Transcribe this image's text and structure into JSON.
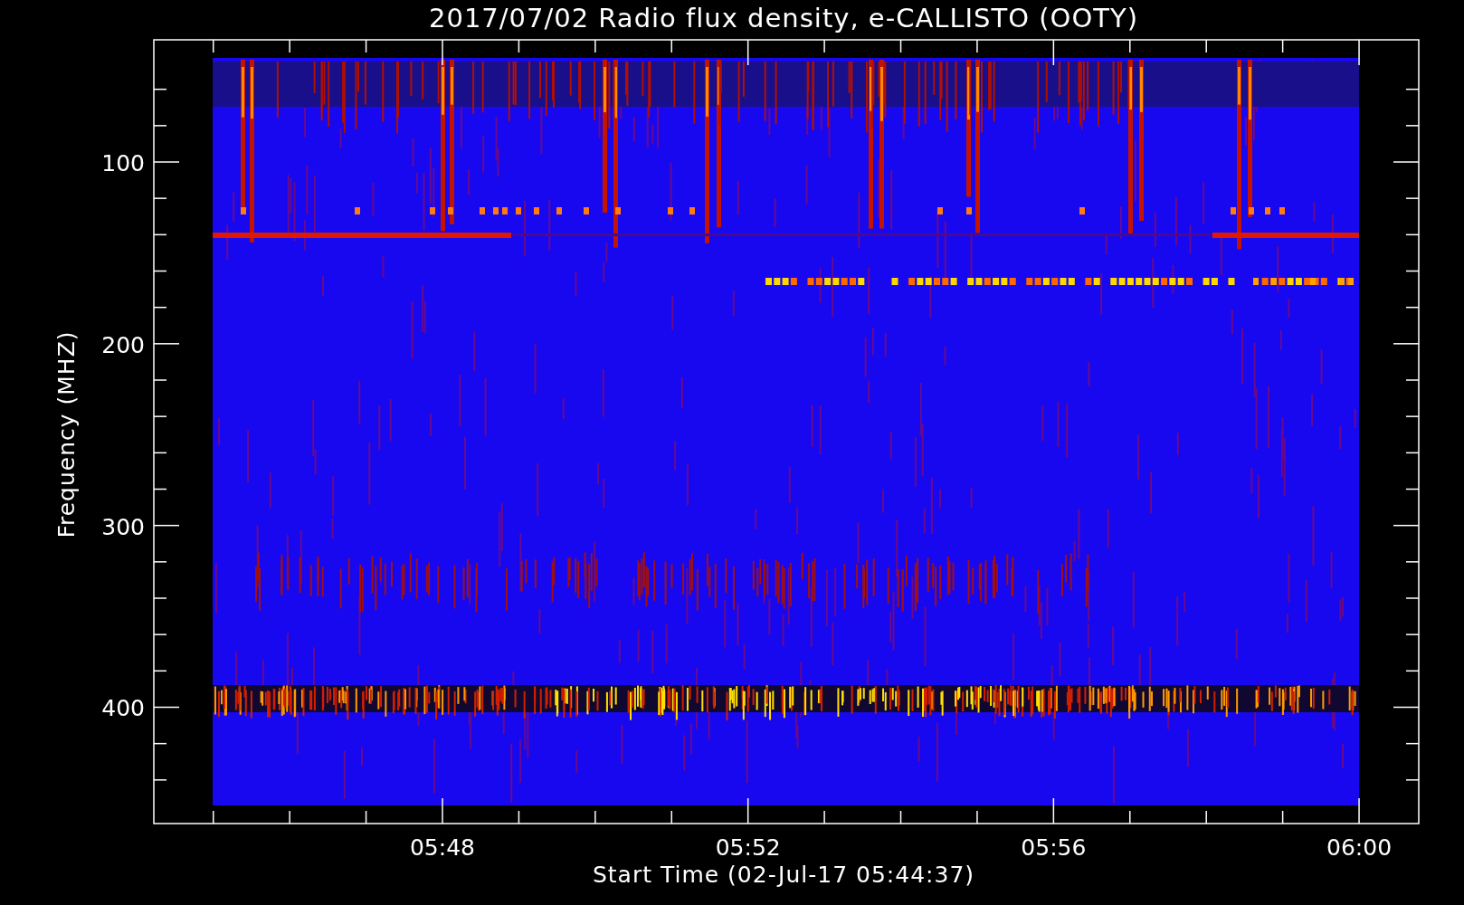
{
  "title": "2017/07/02  Radio flux density, e-CALLISTO (OOTY)",
  "y_axis": {
    "label": "Frequency (MHZ)",
    "tick_labels": [
      "100",
      "200",
      "300",
      "400"
    ]
  },
  "x_axis": {
    "label": "Start Time (02-Jul-17 05:44:37)",
    "tick_labels": [
      "05:48",
      "05:52",
      "05:56",
      "06:00"
    ]
  }
}
